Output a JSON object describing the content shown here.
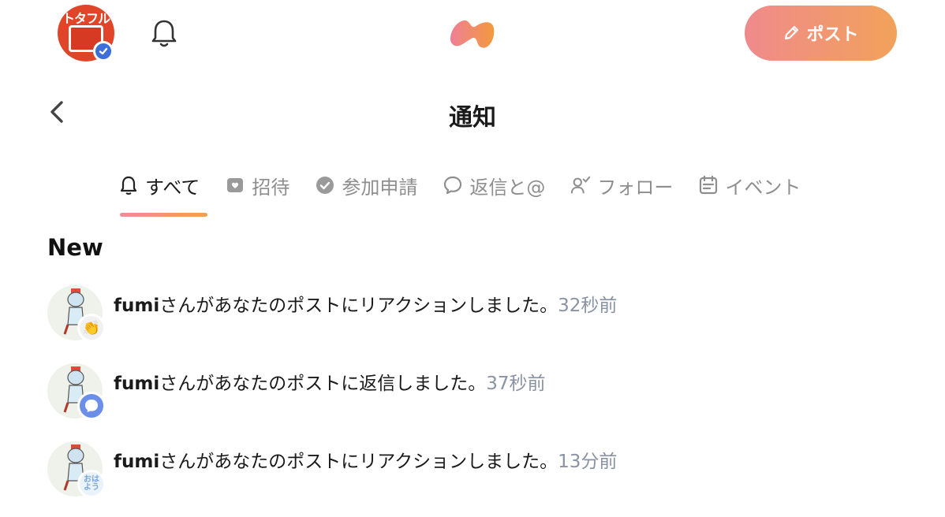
{
  "topbar": {
    "avatar_sign": "トタフル",
    "post_button_label": "ポスト"
  },
  "header": {
    "title": "通知"
  },
  "tabs": [
    {
      "label": "すべて",
      "icon": "bell-icon",
      "active": true
    },
    {
      "label": "招待",
      "icon": "invite-icon",
      "active": false
    },
    {
      "label": "参加申請",
      "icon": "check-circle-icon",
      "active": false
    },
    {
      "label": "返信と@",
      "icon": "speech-bubble-icon",
      "active": false
    },
    {
      "label": "フォロー",
      "icon": "user-check-icon",
      "active": false
    },
    {
      "label": "イベント",
      "icon": "calendar-icon",
      "active": false
    }
  ],
  "section": {
    "title": "New"
  },
  "notifications": [
    {
      "user": "fumi",
      "message": "さんがあなたのポストにリアクションしました。",
      "time": "32秒前",
      "badge": "clap-emoji"
    },
    {
      "user": "fumi",
      "message": "さんがあなたのポストに返信しました。",
      "time": "37秒前",
      "badge": "reply-bubble"
    },
    {
      "user": "fumi",
      "message": "さんがあなたのポストにリアクションしました。",
      "time": "13分前",
      "badge": "ohayo-sticker",
      "badge_text": "おはよう"
    }
  ],
  "colors": {
    "accent_start": "#ef8a8c",
    "accent_end": "#f2a25a",
    "muted": "#8e8e8e",
    "time": "#8a93a3"
  }
}
